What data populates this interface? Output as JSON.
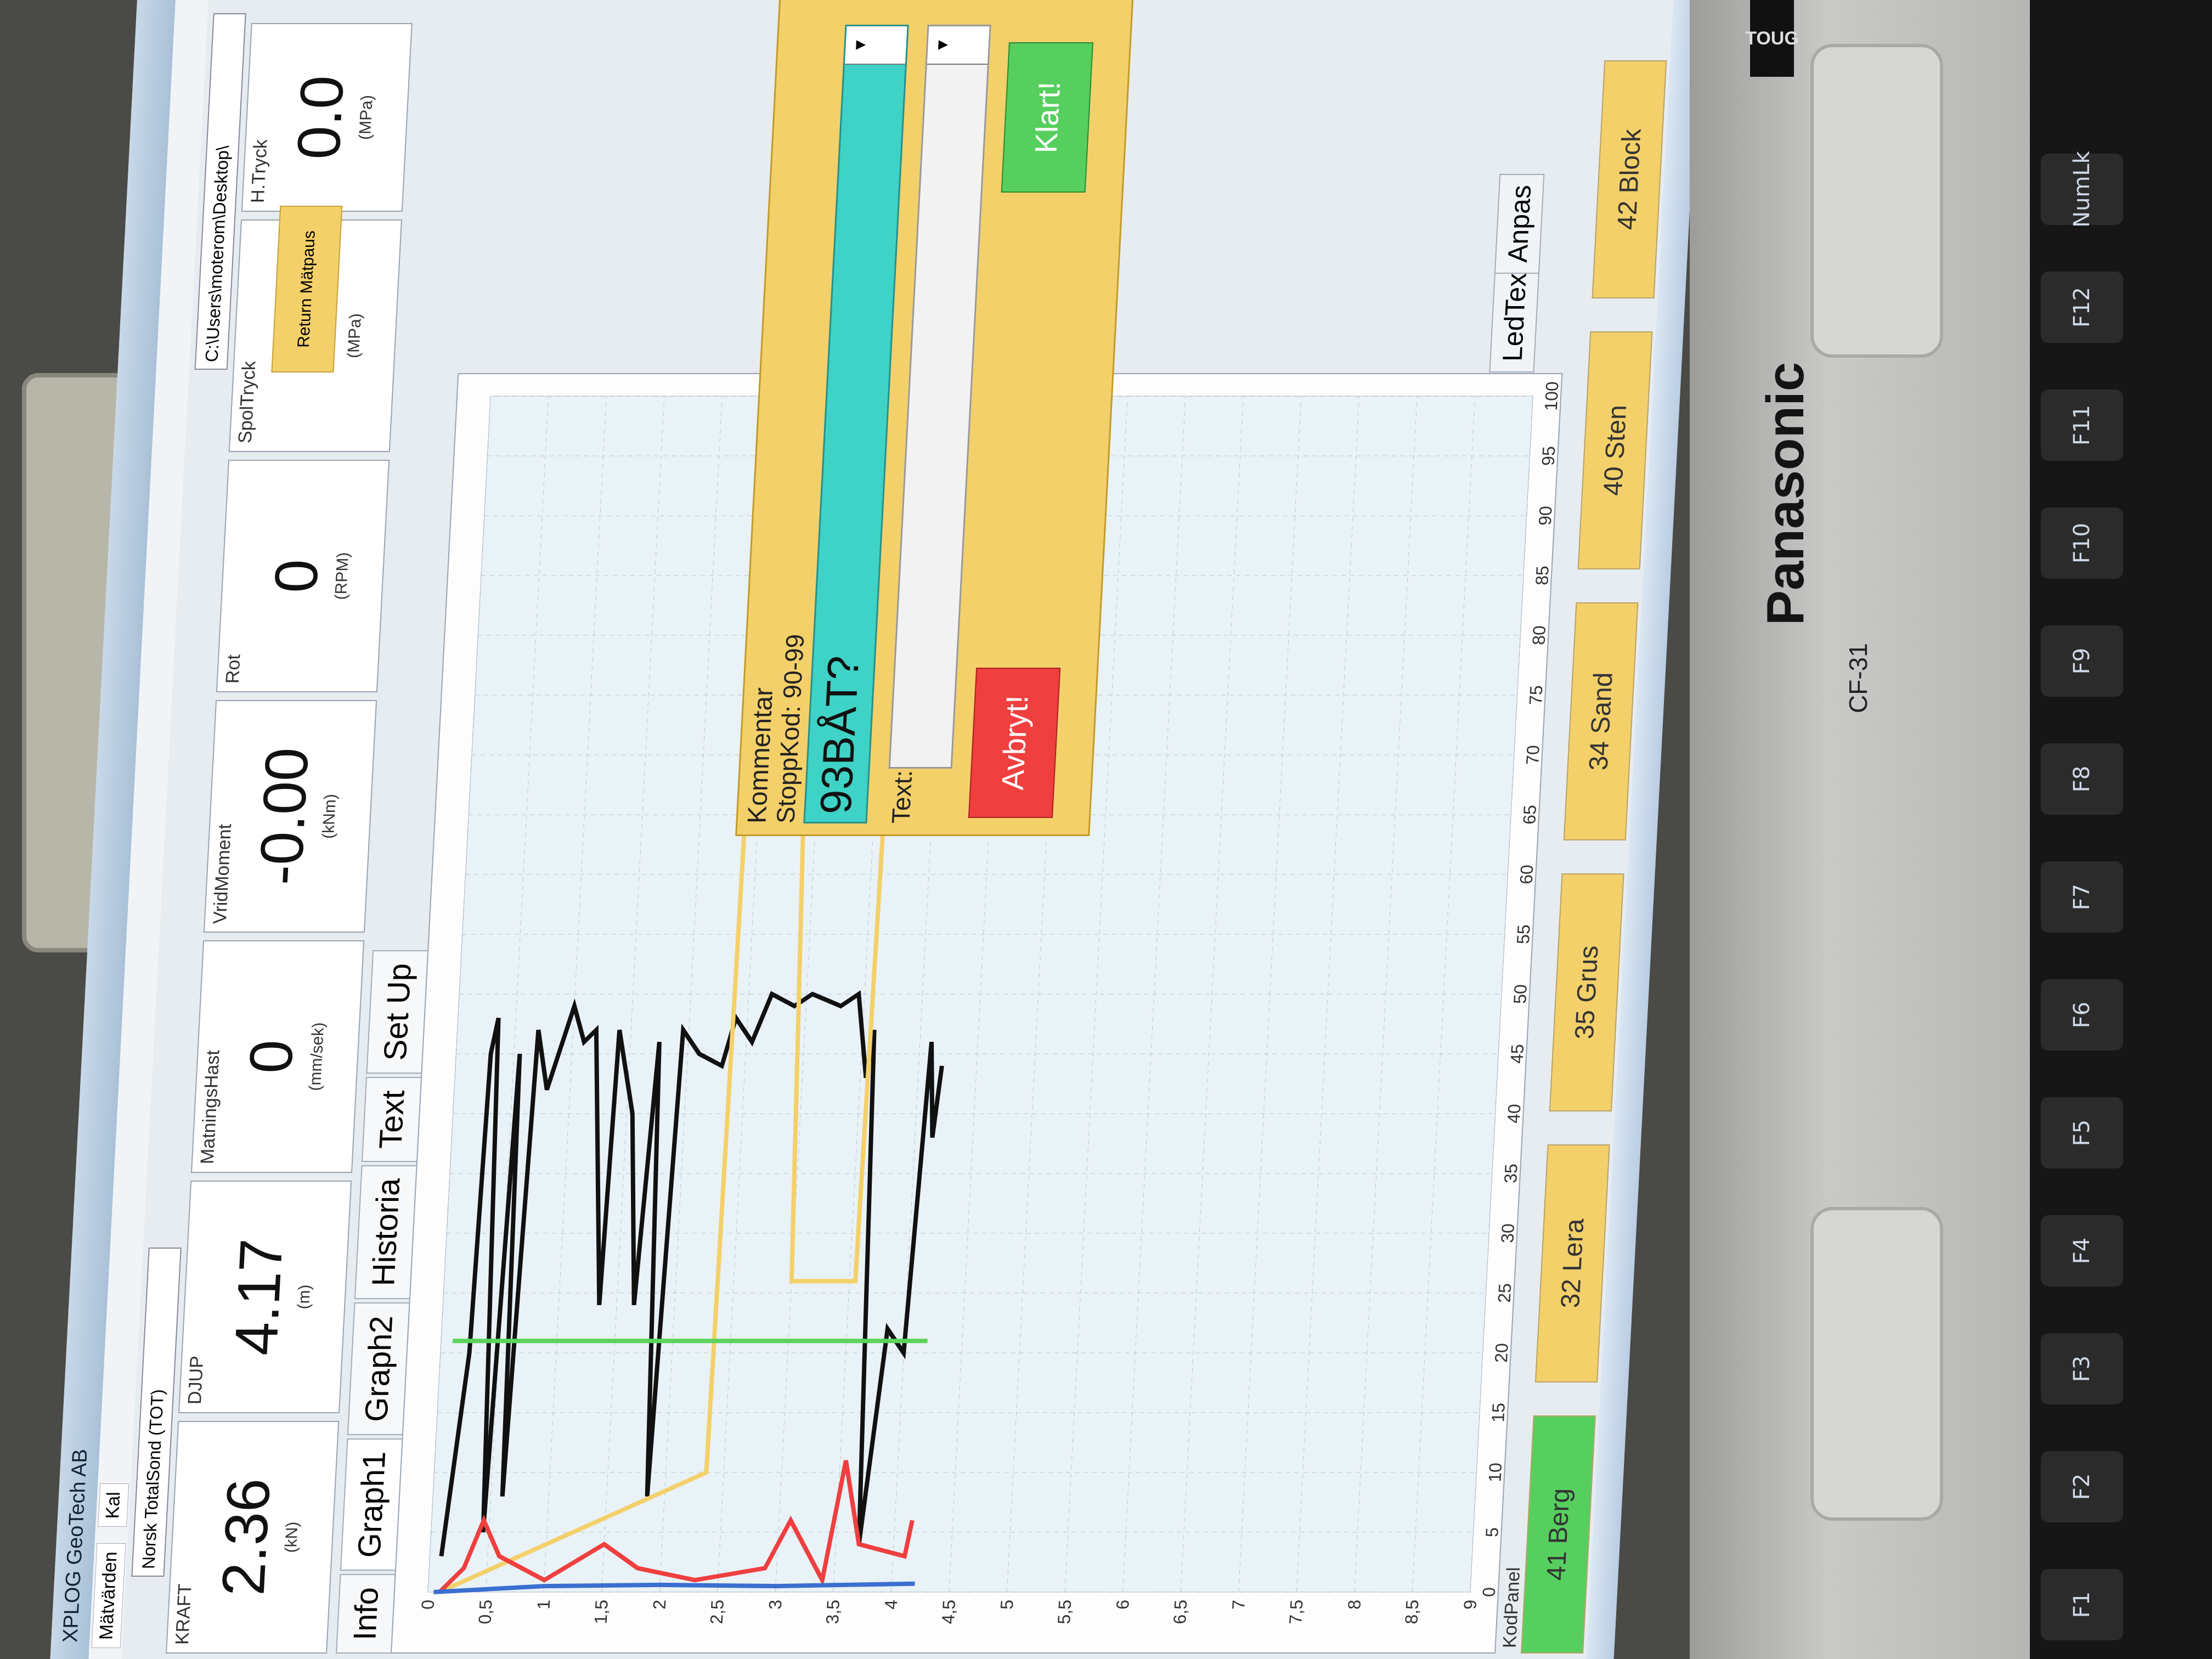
{
  "window": {
    "title": "XPLOG GeoTech AB",
    "menu": [
      "Mätvärden",
      "Kal"
    ],
    "method": "Norsk TotalSond (TOT)",
    "path": "C:\\Users\\moterom\\Desktop\\"
  },
  "meters": [
    {
      "label": "KRAFT",
      "value": "2.36",
      "unit": "(kN)"
    },
    {
      "label": "DJUP",
      "value": "4.17",
      "unit": "(m)"
    },
    {
      "label": "MatningsHast",
      "value": "0",
      "unit": "(mm/sek)"
    },
    {
      "label": "VridMoment",
      "value": "-0.00",
      "unit": "(kNm)"
    },
    {
      "label": "Rot",
      "value": "0",
      "unit": "(RPM)"
    },
    {
      "label": "SpolTryck",
      "value": "0",
      "unit": "(MPa)"
    },
    {
      "label": "H.Tryck",
      "value": "0.0",
      "unit": "(MPa)"
    }
  ],
  "tabs": [
    "Info",
    "Graph1",
    "Graph2",
    "Historia",
    "Text",
    "Set Up"
  ],
  "side": {
    "return_button": "Return Mätpaus",
    "tabs": [
      "LedText",
      "Anpas"
    ]
  },
  "chart_data": {
    "type": "line",
    "ylabel": "",
    "xlabel": "",
    "y_ticks": [
      "0",
      "0,5",
      "1",
      "1,5",
      "2",
      "2,5",
      "3",
      "3,5",
      "4",
      "4,5",
      "5",
      "5,5",
      "6",
      "6,5",
      "7",
      "7,5",
      "8",
      "8,5",
      "9"
    ],
    "x_ticks": [
      "0",
      "5",
      "10",
      "15",
      "20",
      "25",
      "30",
      "35",
      "40",
      "45",
      "50",
      "55",
      "60",
      "65",
      "70",
      "75",
      "80",
      "85",
      "90",
      "95",
      "100"
    ],
    "ylim": [
      0,
      9
    ],
    "xlim": [
      0,
      100
    ],
    "grid": true,
    "series": [
      {
        "color": "#111111",
        "points": [
          [
            3,
            0.1
          ],
          [
            20,
            0.25
          ],
          [
            45,
            0.3
          ],
          [
            48,
            0.35
          ],
          [
            5,
            0.45
          ],
          [
            45,
            0.55
          ],
          [
            8,
            0.6
          ],
          [
            47,
            0.7
          ],
          [
            42,
            0.8
          ],
          [
            49,
            1.0
          ],
          [
            46,
            1.1
          ],
          [
            47,
            1.2
          ],
          [
            24,
            1.35
          ],
          [
            47,
            1.4
          ],
          [
            40,
            1.55
          ],
          [
            24,
            1.65
          ],
          [
            46,
            1.75
          ],
          [
            8,
            1.85
          ],
          [
            47,
            1.95
          ],
          [
            45,
            2.1
          ],
          [
            44,
            2.3
          ],
          [
            48,
            2.4
          ],
          [
            46,
            2.55
          ],
          [
            50,
            2.7
          ],
          [
            49,
            2.9
          ],
          [
            50,
            3.05
          ],
          [
            49,
            3.3
          ],
          [
            50,
            3.45
          ],
          [
            43,
            3.55
          ],
          [
            47,
            3.6
          ],
          [
            4,
            3.7
          ],
          [
            22,
            3.85
          ],
          [
            20,
            4.0
          ],
          [
            46,
            4.1
          ],
          [
            38,
            4.15
          ],
          [
            44,
            4.2
          ]
        ]
      },
      {
        "color": "#f4d06a",
        "points": [
          [
            0,
            0.1
          ],
          [
            10,
            2.35
          ],
          [
            80,
            2.4
          ],
          [
            80,
            2.85
          ],
          [
            26,
            3.0
          ],
          [
            26,
            3.55
          ],
          [
            80,
            3.6
          ]
        ]
      },
      {
        "color": "#ef3f3f",
        "points": [
          [
            0,
            0.1
          ],
          [
            2,
            0.3
          ],
          [
            6,
            0.45
          ],
          [
            3,
            0.6
          ],
          [
            1,
            1.0
          ],
          [
            4,
            1.5
          ],
          [
            2,
            1.8
          ],
          [
            1,
            2.3
          ],
          [
            2,
            2.9
          ],
          [
            6,
            3.1
          ],
          [
            1,
            3.4
          ],
          [
            11,
            3.55
          ],
          [
            4,
            3.7
          ],
          [
            3,
            4.1
          ],
          [
            6,
            4.15
          ]
        ]
      },
      {
        "color": "#3a6fd1",
        "points": [
          [
            0,
            0.05
          ],
          [
            0.5,
            1.0
          ],
          [
            0.6,
            2.0
          ],
          [
            0.5,
            3.0
          ],
          [
            0.7,
            4.2
          ]
        ]
      },
      {
        "color": "#5ad45a",
        "points": [
          [
            21,
            0.1
          ],
          [
            21,
            4.2
          ]
        ]
      }
    ]
  },
  "dialog": {
    "title": "Kommentar",
    "hint": "StoppKod: 90-99",
    "stop_value": "93BÅT?",
    "text_label": "Text:",
    "text_value": "",
    "abort_label": "Avbryt!",
    "ok_label": "Klart!"
  },
  "kodpanel": {
    "label": "KodPanel",
    "items": [
      {
        "label": "41 Berg",
        "color": "#56cf5e"
      },
      {
        "label": "32 Lera",
        "color": "#f4d06a"
      },
      {
        "label": "35 Grus",
        "color": "#f4d06a"
      },
      {
        "label": "34 Sand",
        "color": "#f4d06a"
      },
      {
        "label": "40 Sten",
        "color": "#f4d06a"
      },
      {
        "label": "42 Block",
        "color": "#f4d06a"
      }
    ]
  },
  "hardware": {
    "brand": "Panasonic",
    "model": "CF-31",
    "badge": "TOUG",
    "keys": [
      "F1",
      "F2",
      "F3",
      "F4",
      "F5",
      "F6",
      "F7",
      "F8",
      "F9",
      "F10",
      "F11",
      "F12",
      "NumLk"
    ]
  }
}
